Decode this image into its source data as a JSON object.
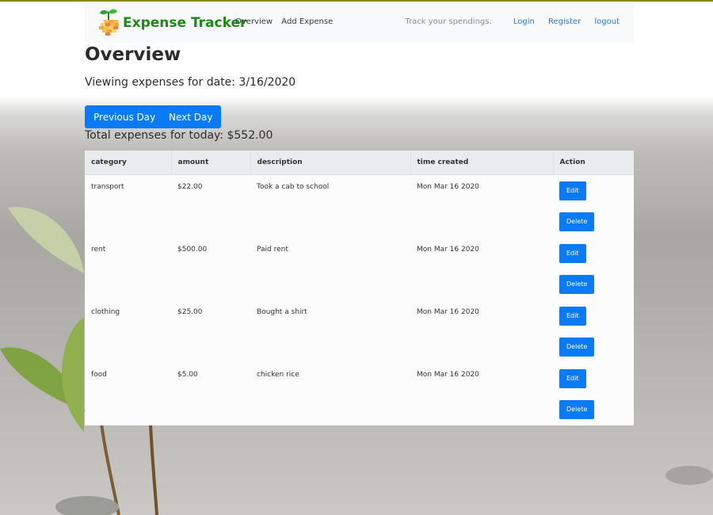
{
  "navbar": {
    "brand": "Expense Tracker",
    "links_left": [
      "Overview",
      "Add Expense"
    ],
    "tagline": "Track your spendings.",
    "links_right": [
      "Login",
      "Register",
      "logout"
    ]
  },
  "page": {
    "title": "Overview",
    "viewing": "Viewing expenses for date: 3/16/2020",
    "prev_label": "Previous Day",
    "next_label": "Next Day",
    "total": "Total expenses for today: $552.00"
  },
  "table": {
    "headers": [
      "category",
      "amount",
      "description",
      "time created",
      "Action"
    ],
    "rows": [
      {
        "category": "transport",
        "amount": "$22.00",
        "description": "Took a cab to school",
        "time": "Mon Mar 16 2020"
      },
      {
        "category": "rent",
        "amount": "$500.00",
        "description": "Paid rent",
        "time": "Mon Mar 16 2020"
      },
      {
        "category": "clothing",
        "amount": "$25.00",
        "description": "Bought a shirt",
        "time": "Mon Mar 16 2020"
      },
      {
        "category": "food",
        "amount": "$5.00",
        "description": "chicken rice",
        "time": "Mon Mar 16 2020"
      }
    ],
    "edit_label": "Edit",
    "delete_label": "Delete"
  },
  "colors": {
    "brand": "#1e8a16",
    "primary": "#0a7bf7",
    "link": "#2d7ad6"
  },
  "icons": {
    "logo": "sprout-coins-icon"
  }
}
